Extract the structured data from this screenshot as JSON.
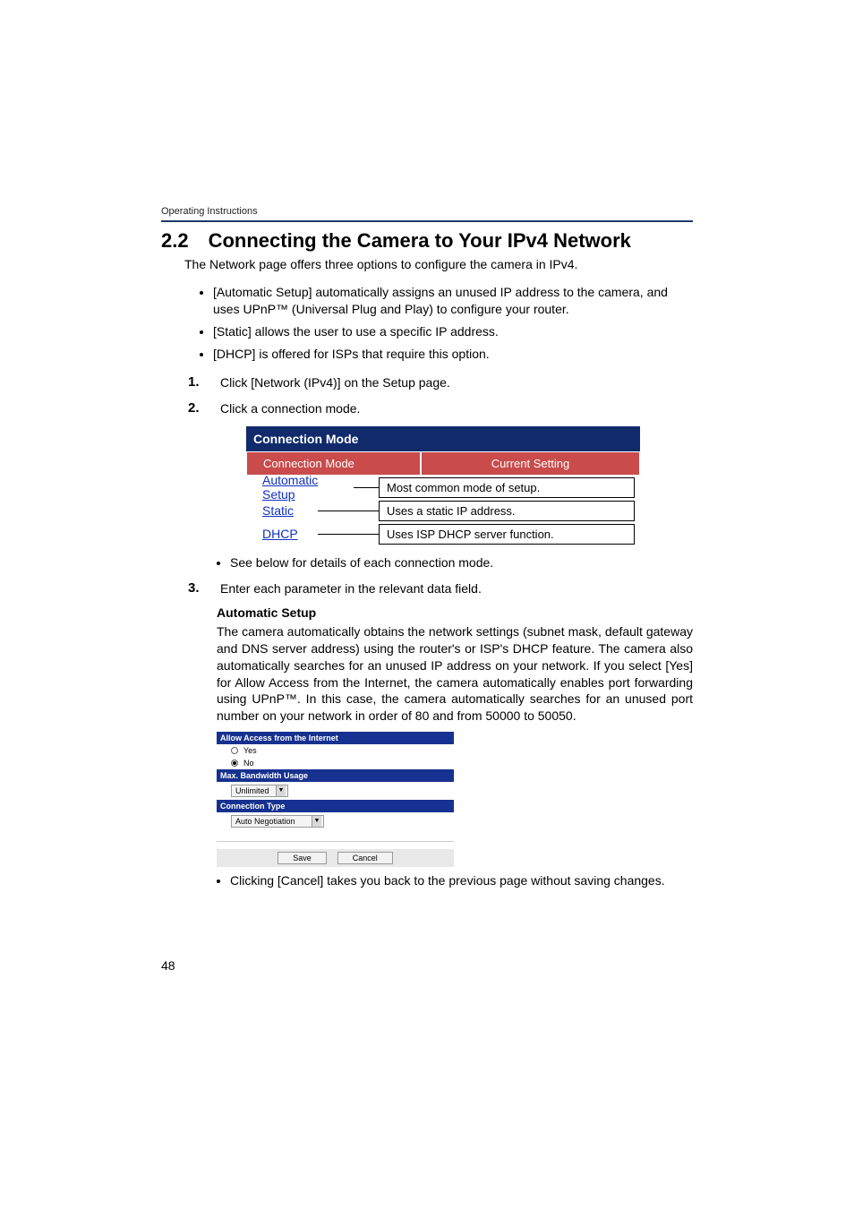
{
  "header": {
    "running": "Operating Instructions"
  },
  "section": {
    "number": "2.2",
    "title": "Connecting the Camera to Your IPv4 Network"
  },
  "intro": "The Network page offers three options to configure the camera in IPv4.",
  "bullets": {
    "auto": "[Automatic Setup] automatically assigns an unused IP address to the camera, and uses UPnP™ (Universal Plug and Play) to configure your router.",
    "static": "[Static] allows the user to use a specific IP address.",
    "dhcp": "[DHCP] is offered for ISPs that require this option."
  },
  "steps": {
    "s1_num": "1.",
    "s1": "Click [Network (IPv4)] on the Setup page.",
    "s2_num": "2.",
    "s2": "Click a connection mode.",
    "s3_num": "3.",
    "s3": "Enter each parameter in the relevant data field."
  },
  "conn_table": {
    "panel_title": "Connection Mode",
    "hdr_mode": "Connection Mode",
    "hdr_setting": "Current Setting",
    "rows": [
      {
        "link": "Automatic Setup",
        "desc": "Most common mode of setup."
      },
      {
        "link": "Static",
        "desc": "Uses a static IP address."
      },
      {
        "link": "DHCP",
        "desc": "Uses ISP DHCP server function."
      }
    ]
  },
  "sub_note": "See below for details of each connection mode.",
  "autosetup": {
    "heading": "Automatic Setup",
    "body": "The camera automatically obtains the network settings (subnet mask, default gateway and DNS server address) using the router's or ISP's DHCP feature. The camera also automatically searches for an unused IP address on your network. If you select [Yes] for Allow Access from the Internet, the camera automatically enables port forwarding using UPnP™. In this case, the camera automatically searches for an unused port number on your network in  order of 80 and from 50000 to 50050."
  },
  "settings_panel": {
    "sec1": "Allow Access from the Internet",
    "yes": "Yes",
    "no": "No",
    "sec2": "Max. Bandwidth Usage",
    "bw_value": "Unlimited",
    "sec3": "Connection Type",
    "ct_value": "Auto Negotiation",
    "save": "Save",
    "cancel": "Cancel"
  },
  "cancel_note": "Clicking [Cancel] takes you back to the previous page without saving changes.",
  "page_number": "48"
}
